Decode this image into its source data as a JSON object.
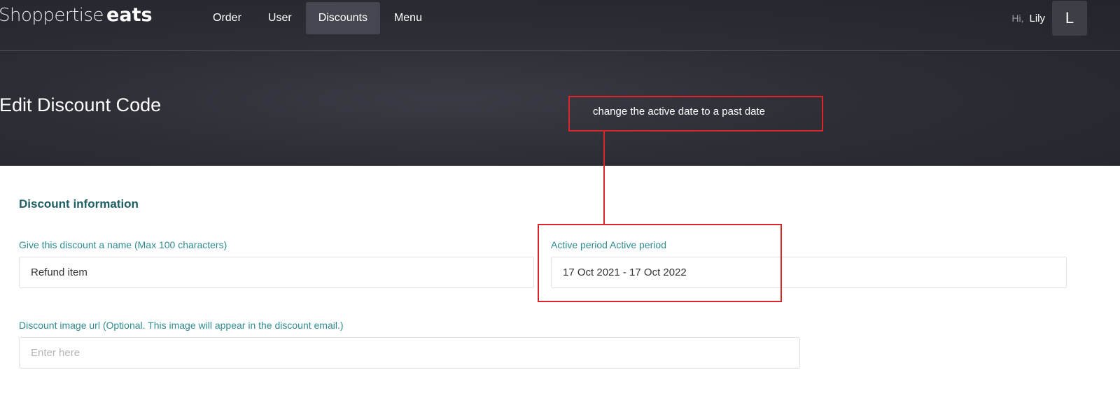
{
  "header": {
    "brand_main": "Shoppertise",
    "brand_sub": "eats",
    "nav": [
      {
        "label": "Order",
        "active": false
      },
      {
        "label": "User",
        "active": false
      },
      {
        "label": "Discounts",
        "active": true
      },
      {
        "label": "Menu",
        "active": false
      }
    ],
    "greeting": "Hi,",
    "user_name": "Lily",
    "avatar_initial": "L"
  },
  "page": {
    "title": "Edit Discount Code"
  },
  "annotation": {
    "note": "change the active date to a past date",
    "color": "#d9262b"
  },
  "form": {
    "section_title": "Discount information",
    "name_label": "Give this discount a name (Max 100 characters)",
    "name_value": "Refund item",
    "period_label": "Active period Active period",
    "period_value": "17 Oct 2021 - 17 Oct 2022",
    "image_label": "Discount image url (Optional. This image will appear in the discount email.)",
    "image_placeholder": "Enter here"
  },
  "colors": {
    "header_bg": "#2c2d35",
    "accent_teal": "#2e8b8f",
    "title_teal": "#1e5f63"
  }
}
